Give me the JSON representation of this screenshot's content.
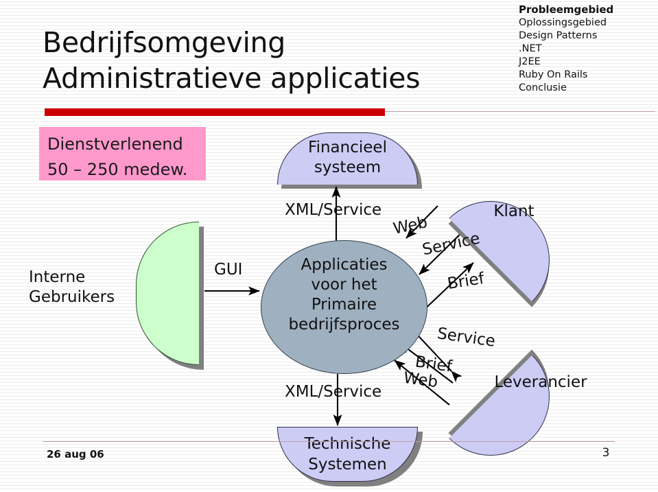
{
  "slide": {
    "title_line1": "Bedrijfsomgeving",
    "title_line2": "Administratieve applicaties"
  },
  "nav": {
    "items": [
      {
        "label": "Probleemgebied",
        "active": true
      },
      {
        "label": "Oplossingsgebied",
        "active": false
      },
      {
        "label": "Design Patterns",
        "active": false
      },
      {
        "label": ".NET",
        "active": false
      },
      {
        "label": "J2EE",
        "active": false
      },
      {
        "label": "Ruby On Rails",
        "active": false
      },
      {
        "label": "Conclusie",
        "active": false
      }
    ]
  },
  "info_box": {
    "line1": "Dienstverlenend",
    "line2": "50 – 250 medew."
  },
  "diagram": {
    "financieel_systeem": "Financieel\nsysteem",
    "technische_systemen": "Technische\nSystemen",
    "interne_gebruikers": "Interne\nGebruikers",
    "central_ellipse": "Applicaties\nvoor het\nPrimaire\nbedrijfsproces",
    "klant": "Klant",
    "leverancier": "Leverancier",
    "connector_gui": "GUI",
    "connector_xml_top": "XML/Service",
    "connector_xml_bottom": "XML/Service",
    "connector_web_klant": "Web",
    "connector_service_klant": "Service",
    "connector_brief_klant": "Brief",
    "connector_service_leverancier": "Service",
    "connector_brief_leverancier": "Brief",
    "connector_web_leverancier": "Web"
  },
  "footer": {
    "date": "26 aug 06",
    "page_number": "3"
  },
  "colors": {
    "accent_red": "#cc0000",
    "pink_box": "#ff99cc",
    "lavender_shape": "#ccccf5",
    "green_shape": "#ccffcc",
    "ellipse_fill": "#9fb0c0",
    "shadow_gray": "#808080"
  }
}
